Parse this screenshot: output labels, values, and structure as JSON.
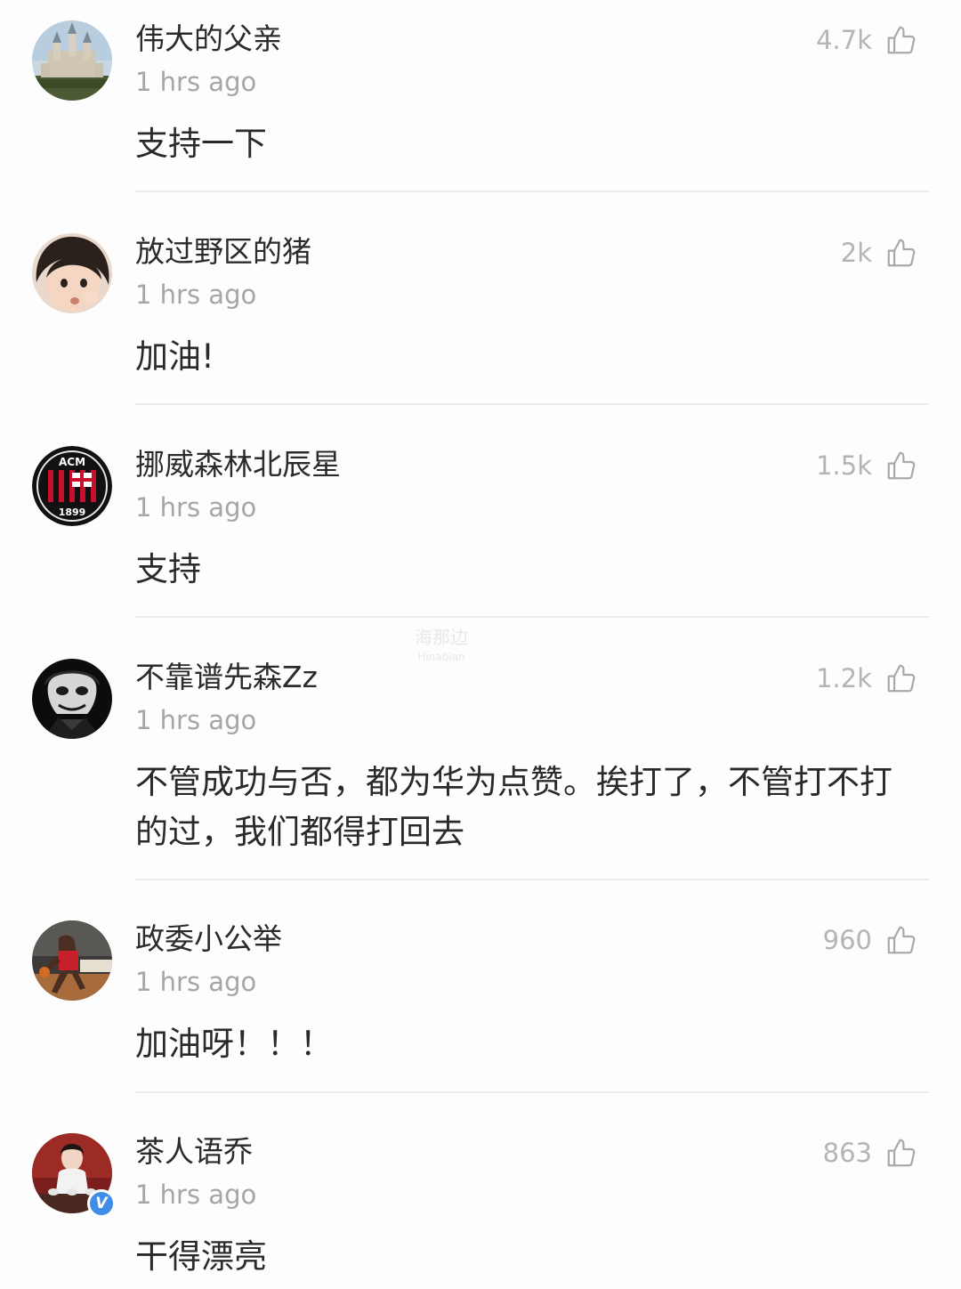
{
  "watermark": {
    "line1": "海那边",
    "line2": "Hinabian"
  },
  "comments": [
    {
      "username": "伟大的父亲",
      "time": "1 hrs ago",
      "likes": "4.7k",
      "text": "支持一下",
      "avatar_icon": "castle-avatar-icon"
    },
    {
      "username": "放过野区的猪",
      "time": "1 hrs ago",
      "likes": "2k",
      "text": "加油!",
      "avatar_icon": "child-avatar-icon"
    },
    {
      "username": "挪威森林北辰星",
      "time": "1 hrs ago",
      "likes": "1.5k",
      "text": "支持",
      "avatar_icon": "ac-milan-crest-avatar-icon",
      "avatar_text": {
        "top": "ACM",
        "bottom": "1899"
      }
    },
    {
      "username": "不靠谱先森Zz",
      "time": "1 hrs ago",
      "likes": "1.2k",
      "text": "不管成功与否，都为华为点赞。挨打了，不管打不打的过，我们都得打回去",
      "avatar_icon": "joker-avatar-icon"
    },
    {
      "username": "政委小公举",
      "time": "1 hrs ago",
      "likes": "960",
      "text": "加油呀！！！",
      "avatar_icon": "basketball-player-avatar-icon"
    },
    {
      "username": "茶人语乔",
      "time": "1 hrs ago",
      "likes": "863",
      "text": "干得漂亮",
      "avatar_icon": "tea-lady-avatar-icon",
      "verified_badge": "V"
    }
  ],
  "colors": {
    "background": "#fdfdfd",
    "text_primary": "#2b2b2b",
    "text_secondary": "#a6a6a6",
    "divider": "#ebebeb",
    "verified_badge": "#3e8ee8"
  }
}
